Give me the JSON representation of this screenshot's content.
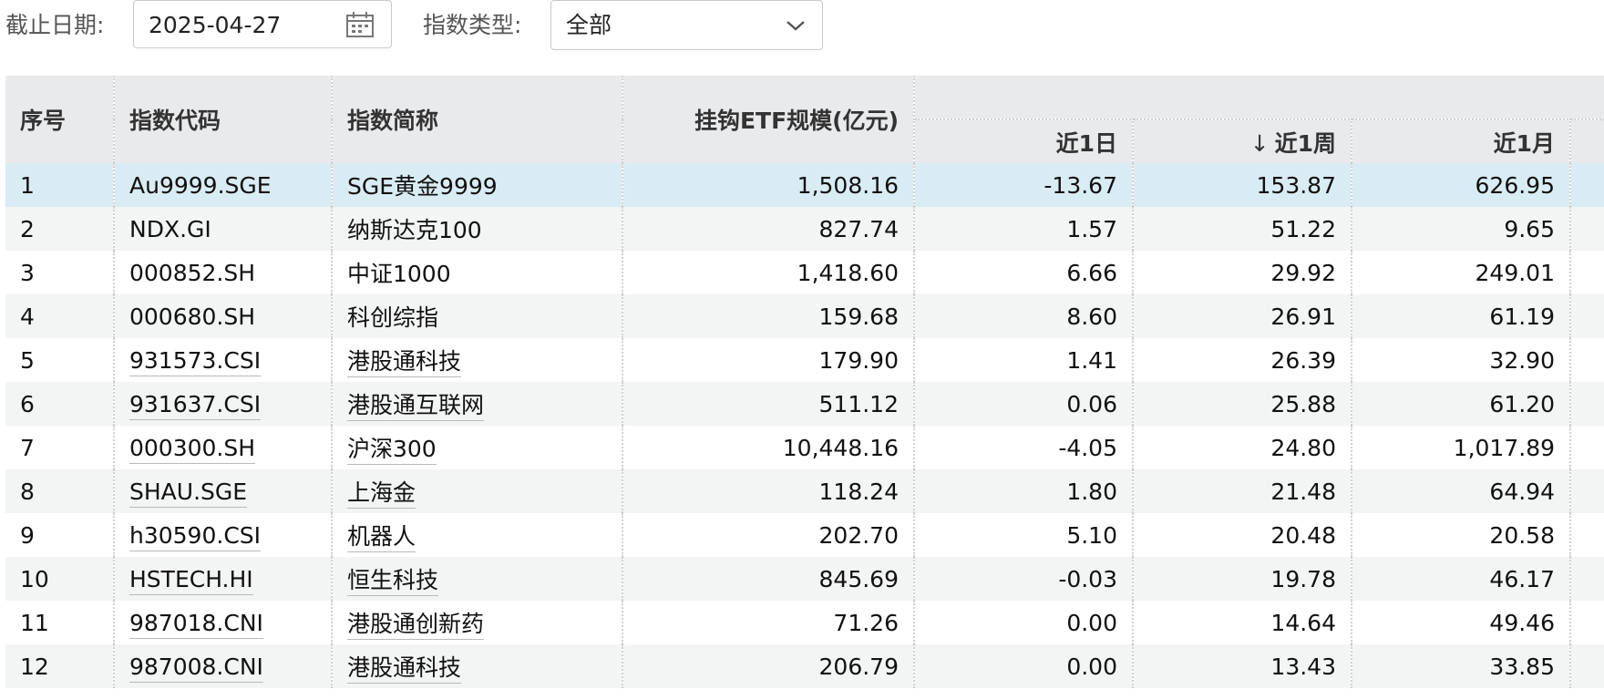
{
  "filters": {
    "date_label": "截止日期:",
    "date_value": "2025-04-27",
    "type_label": "指数类型:",
    "type_value": "全部"
  },
  "table": {
    "headers": {
      "index": "序号",
      "code": "指数代码",
      "name": "指数简称",
      "etf_size": "挂钩ETF规模(亿元)",
      "d1": "近1日",
      "w1": "近1周",
      "m1": "近1月",
      "sort_arrow": "↓"
    },
    "rows": [
      {
        "index": "1",
        "code": "Au9999.SGE",
        "name": "SGE黄金9999",
        "etf_size": "1,508.16",
        "d1": "-13.67",
        "w1": "153.87",
        "m1": "626.95",
        "linked": false
      },
      {
        "index": "2",
        "code": "NDX.GI",
        "name": "纳斯达克100",
        "etf_size": "827.74",
        "d1": "1.57",
        "w1": "51.22",
        "m1": "9.65",
        "linked": false
      },
      {
        "index": "3",
        "code": "000852.SH",
        "name": "中证1000",
        "etf_size": "1,418.60",
        "d1": "6.66",
        "w1": "29.92",
        "m1": "249.01",
        "linked": false
      },
      {
        "index": "4",
        "code": "000680.SH",
        "name": "科创综指",
        "etf_size": "159.68",
        "d1": "8.60",
        "w1": "26.91",
        "m1": "61.19",
        "linked": false
      },
      {
        "index": "5",
        "code": "931573.CSI",
        "name": "港股通科技",
        "etf_size": "179.90",
        "d1": "1.41",
        "w1": "26.39",
        "m1": "32.90",
        "linked": true
      },
      {
        "index": "6",
        "code": "931637.CSI",
        "name": "港股通互联网",
        "etf_size": "511.12",
        "d1": "0.06",
        "w1": "25.88",
        "m1": "61.20",
        "linked": true
      },
      {
        "index": "7",
        "code": "000300.SH",
        "name": "沪深300",
        "etf_size": "10,448.16",
        "d1": "-4.05",
        "w1": "24.80",
        "m1": "1,017.89",
        "linked": true
      },
      {
        "index": "8",
        "code": "SHAU.SGE",
        "name": "上海金",
        "etf_size": "118.24",
        "d1": "1.80",
        "w1": "21.48",
        "m1": "64.94",
        "linked": true
      },
      {
        "index": "9",
        "code": "h30590.CSI",
        "name": "机器人",
        "etf_size": "202.70",
        "d1": "5.10",
        "w1": "20.48",
        "m1": "20.58",
        "linked": true
      },
      {
        "index": "10",
        "code": "HSTECH.HI",
        "name": "恒生科技",
        "etf_size": "845.69",
        "d1": "-0.03",
        "w1": "19.78",
        "m1": "46.17",
        "linked": true
      },
      {
        "index": "11",
        "code": "987018.CNI",
        "name": "港股通创新药",
        "etf_size": "71.26",
        "d1": "0.00",
        "w1": "14.64",
        "m1": "49.46",
        "linked": true
      },
      {
        "index": "12",
        "code": "987008.CNI",
        "name": "港股通科技",
        "etf_size": "206.79",
        "d1": "0.00",
        "w1": "13.43",
        "m1": "33.85",
        "linked": true
      }
    ]
  }
}
